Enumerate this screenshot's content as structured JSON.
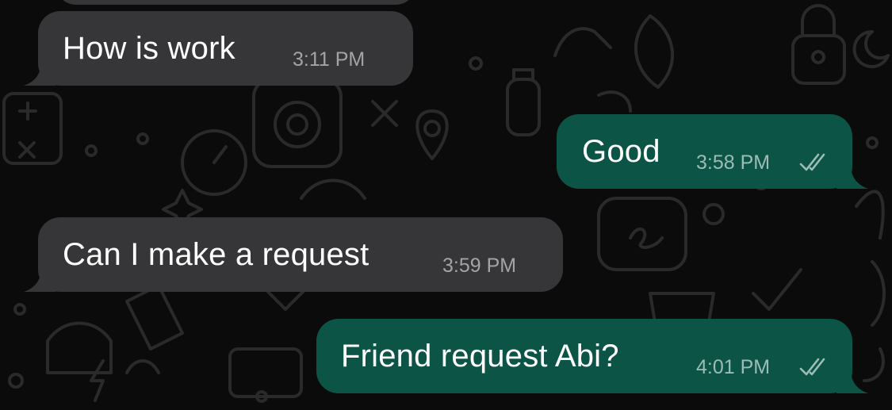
{
  "colors": {
    "background": "#0b0b0b",
    "incoming_bubble": "#363638",
    "outgoing_bubble": "#0c5446",
    "text": "#ffffff",
    "incoming_meta": "#a4a4a6",
    "outgoing_meta": "#9bbdb5"
  },
  "messages": [
    {
      "direction": "incoming",
      "text": "How is work",
      "time": "3:11 PM"
    },
    {
      "direction": "outgoing",
      "text": "Good",
      "time": "3:58 PM",
      "status_icon": "double-check-icon"
    },
    {
      "direction": "incoming",
      "text": "Can I make a request",
      "time": "3:59 PM"
    },
    {
      "direction": "outgoing",
      "text": "Friend request Abi?",
      "time": "4:01 PM",
      "status_icon": "double-check-icon"
    }
  ]
}
